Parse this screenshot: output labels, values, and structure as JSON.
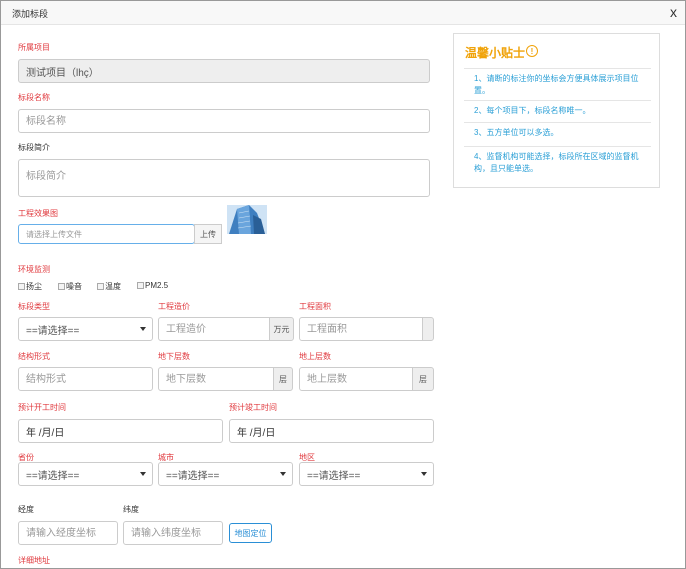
{
  "dialog": {
    "title": "添加标段",
    "close_label": "x"
  },
  "form": {
    "project_label": "所属项目",
    "project_value": "测试项目（lhç）",
    "name_label": "标段名称",
    "name_placeholder": "标段名称",
    "intro_label": "标段简介",
    "intro_placeholder": "标段简介",
    "image_label": "工程效果图",
    "file_placeholder": "请选择上传文件",
    "upload_label": "上传",
    "env_label": "环境监测",
    "env_options": [
      "扬尘",
      "噪音",
      "温度",
      "PM2.5"
    ],
    "type_label": "标段类型",
    "type_value": "==请选择==",
    "cost_label": "工程造价",
    "cost_placeholder": "工程造价",
    "cost_unit": "万元",
    "area_label": "工程面积",
    "area_placeholder": "工程面积",
    "structure_label": "结构形式",
    "structure_placeholder": "结构形式",
    "under_label": "地下层数",
    "under_placeholder": "地下层数",
    "under_unit": "层",
    "above_label": "地上层数",
    "above_placeholder": "地上层数",
    "above_unit": "层",
    "start_label": "预计开工时间",
    "start_value": "年 /月/日",
    "end_label": "预计竣工时间",
    "end_value": "年 /月/日",
    "province_label": "省份",
    "province_value": "==请选择==",
    "city_label": "城市",
    "city_value": "==请选择==",
    "district_label": "地区",
    "district_value": "==请选择==",
    "lng_label": "经度",
    "lng_placeholder": "请输入经度坐标",
    "lat_label": "纬度",
    "lat_placeholder": "请输入纬度坐标",
    "map_button": "地图定位",
    "address_label": "详细地址"
  },
  "tips": {
    "title": "温馨小贴士",
    "icon": "exclamation-circle-icon",
    "items": [
      "1、请断的标注你的坐标会方便具体展示项目位置。",
      "2、每个项目下，标段名称唯一。",
      "3、五方单位可以多选。",
      "4、监督机构可能选择，标段所在区域的监督机构，且只能单选。"
    ]
  },
  "colors": {
    "required_label": "#e0393e",
    "tip_text": "#2a9fd6",
    "tip_title": "#f0a30a"
  }
}
